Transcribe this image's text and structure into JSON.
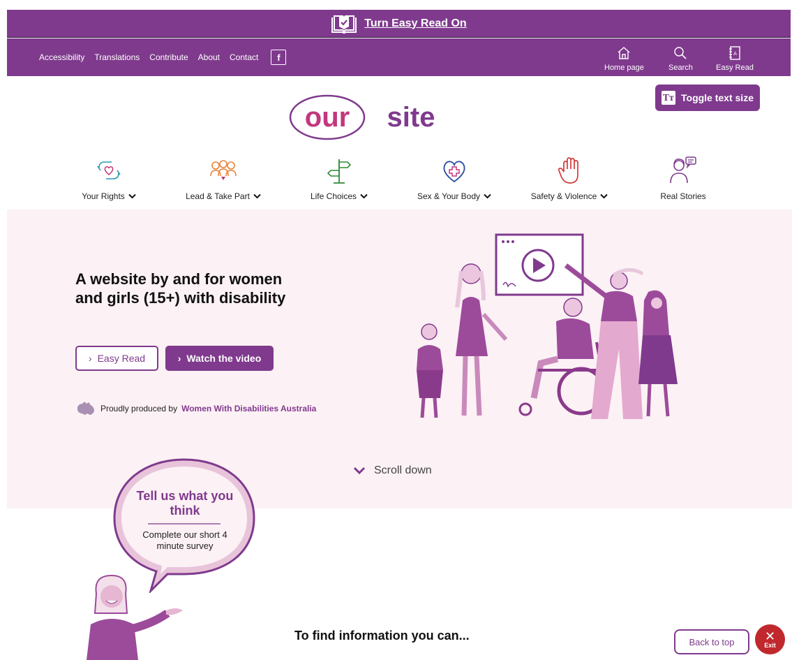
{
  "easy_read_bar": {
    "label": "Turn Easy Read On"
  },
  "top_nav": {
    "links": [
      "Accessibility",
      "Translations",
      "Contribute",
      "About",
      "Contact"
    ],
    "utilities": {
      "home": "Home page",
      "search": "Search",
      "easy_read": "Easy Read"
    }
  },
  "logo": {
    "part1": "our",
    "part2": "site"
  },
  "toggle_text_size": {
    "label": "Toggle text size",
    "icon_text": "Tт"
  },
  "categories": [
    {
      "label": "Your Rights",
      "dropdown": true
    },
    {
      "label": "Lead & Take Part",
      "dropdown": true
    },
    {
      "label": "Life Choices",
      "dropdown": true
    },
    {
      "label": "Sex & Your Body",
      "dropdown": true
    },
    {
      "label": "Safety & Violence",
      "dropdown": true
    },
    {
      "label": "Real Stories",
      "dropdown": false
    }
  ],
  "hero": {
    "title": "A website by and for women and girls (15+) with disability",
    "easy_read_button": "Easy Read",
    "watch_button": "Watch the video",
    "produced_prefix": "Proudly produced by",
    "produced_org": "Women With Disabilities Australia",
    "scroll_label": "Scroll down"
  },
  "survey": {
    "title": "Tell us what you think",
    "subtitle": "Complete our short 4 minute survey"
  },
  "find_info": {
    "title": "To find information you can..."
  },
  "back_to_top": "Back to top",
  "exit": {
    "symbol": "✕",
    "label": "Exit"
  },
  "colors": {
    "brand_purple": "#7f3a8d",
    "hero_bg": "#fcf1f5",
    "exit_red": "#c0282d",
    "logo_pink": "#c2377e"
  }
}
